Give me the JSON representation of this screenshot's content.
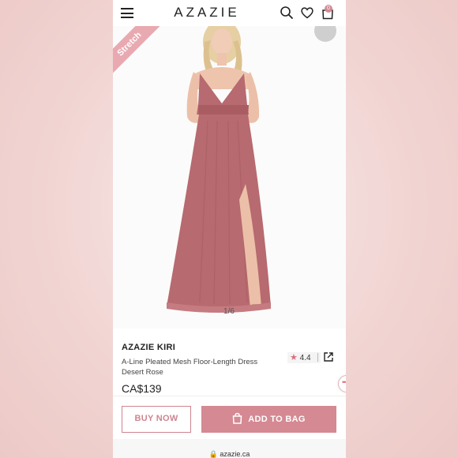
{
  "header": {
    "logo": "AZAZIE",
    "bag_count": "0"
  },
  "gallery": {
    "corner_badge": "Stretch",
    "counter": "1/6"
  },
  "product": {
    "brand": "AZAZIE KIRI",
    "name": "A-Line Pleated Mesh Floor-Length Dress",
    "color": "Desert Rose",
    "price": "CA$139",
    "rating": "4.4",
    "dress_color": "#b76a6f"
  },
  "actions": {
    "buy_now": "BUY NOW",
    "add_to_bag": "ADD TO BAG"
  },
  "browser": {
    "url": "azazie.ca"
  },
  "colors": {
    "accent": "#d48993",
    "accent_text": "#cd8590"
  }
}
